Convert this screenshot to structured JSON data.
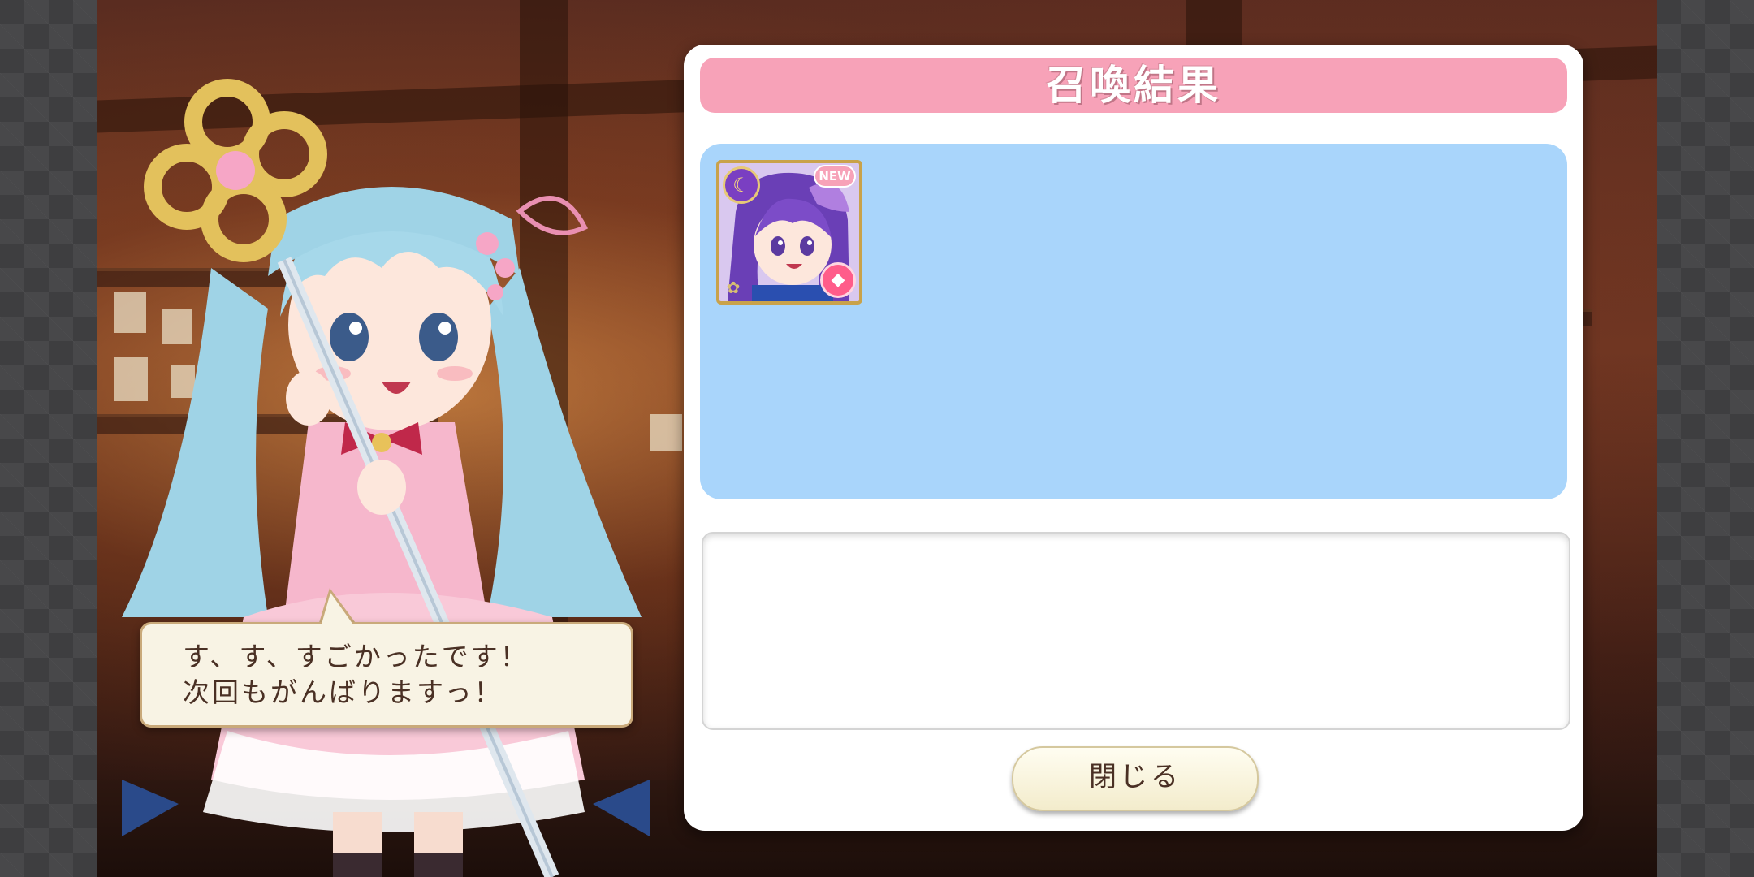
{
  "dialog": {
    "line1": "す、す、すごかったです！",
    "line2": "次回もがんばりますっ！"
  },
  "panel": {
    "title": "召喚結果",
    "results": [
      {
        "badge": "NEW",
        "attribute_icon": "moon-icon",
        "element_icon": "gem-icon"
      }
    ],
    "close_label": "閉じる"
  },
  "colors": {
    "header_pink": "#f7a2b8",
    "result_area_blue": "#a9d5fb",
    "button_cream": "#f3eccc",
    "text_brown": "#4a3024"
  }
}
